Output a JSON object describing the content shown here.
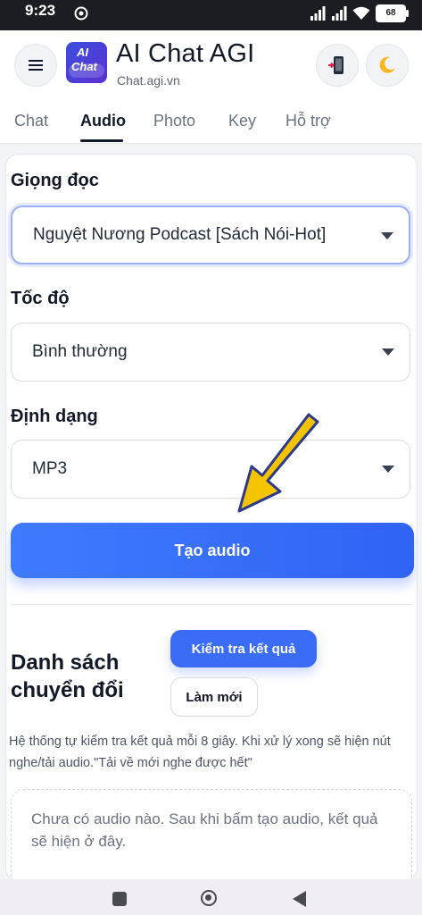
{
  "status_bar": {
    "time": "9:23",
    "battery": "68"
  },
  "header": {
    "logo_line1": "AI",
    "logo_line2": "Chat",
    "title": "AI Chat AGI",
    "subtitle": "Chat.agi.vn",
    "icons": [
      "menu-icon",
      "phone-transfer-icon",
      "moon-icon"
    ]
  },
  "tabs": [
    {
      "label": "Chat"
    },
    {
      "label": "Audio",
      "active": true
    },
    {
      "label": "Photo"
    },
    {
      "label": "Key"
    },
    {
      "label": "Hỗ trợ"
    }
  ],
  "form": {
    "voice_label": "Giọng đọc",
    "voice_value": "Nguyệt Nương Podcast [Sách Nói-Hot]",
    "speed_label": "Tốc độ",
    "speed_value": "Bình thường",
    "format_label": "Định dạng",
    "format_value": "MP3",
    "create_button": "Tạo audio"
  },
  "conversions": {
    "title": "Danh sách chuyển đổi",
    "check_button": "Kiểm tra kết quả",
    "refresh_button": "Làm mới",
    "note": "Hệ thống tự kiểm tra kết quả mỗi 8 giây. Khi xử lý xong sẽ hiện nút nghe/tải audio.\"Tải về mới nghe được hết\"",
    "empty_text": "Chưa có audio nào. Sau khi bấm tạo audio, kết quả sẽ hiện ở đây."
  },
  "colors": {
    "accent": "#3a6cf5",
    "arrow": "#f5c400"
  }
}
